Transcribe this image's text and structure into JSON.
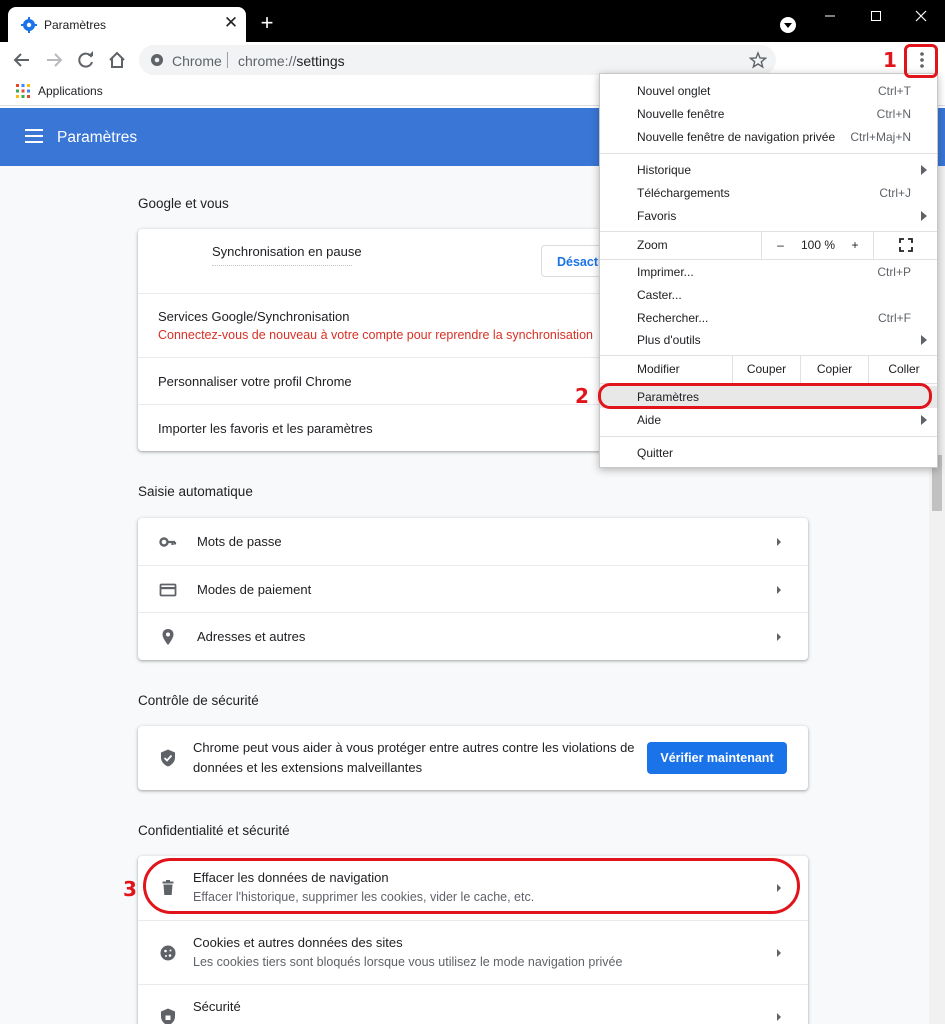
{
  "window": {
    "tab_title": "Paramètres",
    "tab_close": "✕",
    "new_tab": "+"
  },
  "toolbar": {
    "omnibox_site_label": "Chrome",
    "omnibox_url_scheme": "chrome://",
    "omnibox_url_host": "settings"
  },
  "bookmarks": {
    "apps_label": "Applications"
  },
  "settings": {
    "header_title": "Paramètres",
    "google_section": {
      "title": "Google et vous",
      "sync_status": "Synchronisation en pause",
      "disable_button": "Désactiver",
      "google_services_label": "Services Google/Synchronisation",
      "google_services_warning": "Connectez-vous de nouveau à votre compte pour reprendre la synchronisation",
      "customize_profile": "Personnaliser votre profil Chrome",
      "import": "Importer les favoris et les paramètres"
    },
    "autofill_section": {
      "title": "Saisie automatique",
      "items": [
        {
          "label": "Mots de passe",
          "icon": "key-icon"
        },
        {
          "label": "Modes de paiement",
          "icon": "credit-card-icon"
        },
        {
          "label": "Adresses et autres",
          "icon": "location-pin-icon"
        }
      ]
    },
    "safety_section": {
      "title": "Contrôle de sécurité",
      "description_line1": "Chrome peut vous aider à vous protéger entre autres contre les violations de",
      "description_line2": "données et les extensions malveillantes",
      "check_button": "Vérifier maintenant"
    },
    "privacy_section": {
      "title": "Confidentialité et sécurité",
      "items": [
        {
          "label": "Effacer les données de navigation",
          "sub": "Effacer l'historique, supprimer les cookies, vider le cache, etc.",
          "icon": "trash-icon"
        },
        {
          "label": "Cookies et autres données des sites",
          "sub": "Les cookies tiers sont bloqués lorsque vous utilisez le mode navigation privée",
          "icon": "cookie-icon"
        },
        {
          "label": "Sécurité",
          "sub": "",
          "icon": "shield-icon"
        }
      ]
    }
  },
  "chrome_menu": {
    "new_tab": {
      "label": "Nouvel onglet",
      "shortcut": "Ctrl+T"
    },
    "new_window": {
      "label": "Nouvelle fenêtre",
      "shortcut": "Ctrl+N"
    },
    "incognito": {
      "label": "Nouvelle fenêtre de navigation privée",
      "shortcut": "Ctrl+Maj+N"
    },
    "history": {
      "label": "Historique"
    },
    "downloads": {
      "label": "Téléchargements",
      "shortcut": "Ctrl+J"
    },
    "bookmarks": {
      "label": "Favoris"
    },
    "zoom": {
      "label": "Zoom",
      "minus": "–",
      "value": "100 %",
      "plus": "+"
    },
    "print": {
      "label": "Imprimer...",
      "shortcut": "Ctrl+P"
    },
    "cast": {
      "label": "Caster..."
    },
    "find": {
      "label": "Rechercher...",
      "shortcut": "Ctrl+F"
    },
    "more_tools": {
      "label": "Plus d'outils"
    },
    "edit": {
      "label": "Modifier",
      "cut": "Couper",
      "copy": "Copier",
      "paste": "Coller"
    },
    "settings": {
      "label": "Paramètres"
    },
    "help": {
      "label": "Aide"
    },
    "quit": {
      "label": "Quitter"
    }
  },
  "annotations": {
    "step1": "1",
    "step2": "2",
    "step3": "3",
    "color": "#e2141b"
  },
  "colors": {
    "header_blue": "#3a76d6",
    "primary_button": "#1a73e8",
    "warning_red": "#d93025"
  }
}
